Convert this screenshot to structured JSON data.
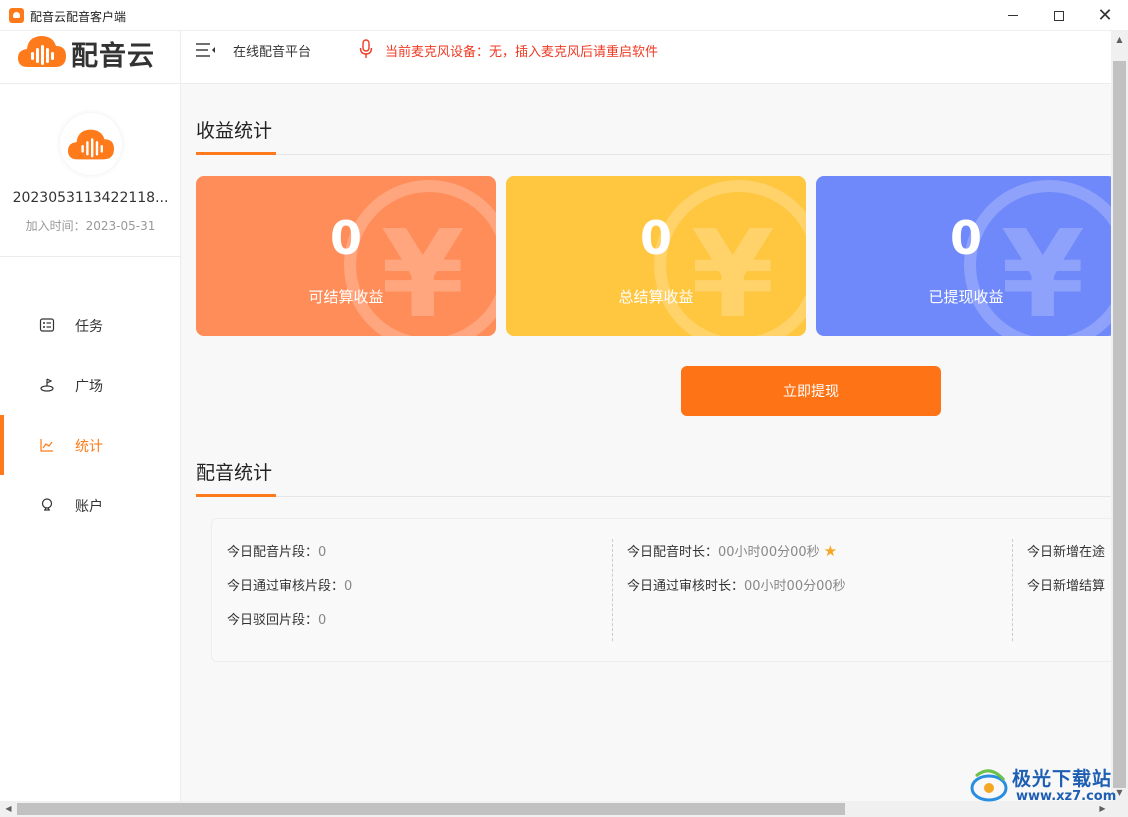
{
  "window": {
    "title": "配音云配音客户端",
    "min_symbol": "",
    "max_symbol": "",
    "close_symbol": "✕"
  },
  "sidebar": {
    "logo_text": "配音云",
    "user_id": "2023053113422118...",
    "join_time": "加入时间：2023-05-31",
    "items": [
      {
        "label": "任务",
        "icon": "task-icon",
        "active": false
      },
      {
        "label": "广场",
        "icon": "square-icon",
        "active": false
      },
      {
        "label": "统计",
        "icon": "chart-icon",
        "active": true
      },
      {
        "label": "账户",
        "icon": "account-icon",
        "active": false
      }
    ]
  },
  "header": {
    "platform": "在线配音平台",
    "mic_message": "当前麦克风设备：无，插入麦克风后请重启软件"
  },
  "earnings": {
    "title": "收益统计",
    "cards": [
      {
        "value": "0",
        "label": "可结算收益"
      },
      {
        "value": "0",
        "label": "总结算收益"
      },
      {
        "value": "0",
        "label": "已提现收益"
      }
    ],
    "yen_symbol": "¥",
    "withdraw_label": "立即提现"
  },
  "dubbing": {
    "title": "配音统计",
    "col1": [
      {
        "label": "今日配音片段：",
        "value": "0"
      },
      {
        "label": "今日通过审核片段：",
        "value": "0"
      },
      {
        "label": "今日驳回片段：",
        "value": "0"
      }
    ],
    "col2": [
      {
        "label": "今日配音时长：",
        "value": "00小时00分00秒"
      },
      {
        "label": "今日通过审核时长：",
        "value": "00小时00分00秒"
      }
    ],
    "col3": [
      {
        "label": "今日新增在途",
        "value": ""
      },
      {
        "label": "今日新增结算",
        "value": ""
      }
    ]
  },
  "watermark": {
    "name": "极光下载站",
    "url": "www.xz7.com"
  },
  "colors": {
    "accent": "#ff7a1a",
    "card1": "#ff8d5a",
    "card2": "#ffc640",
    "card3": "#6f88fa",
    "warning": "#f03a24"
  }
}
